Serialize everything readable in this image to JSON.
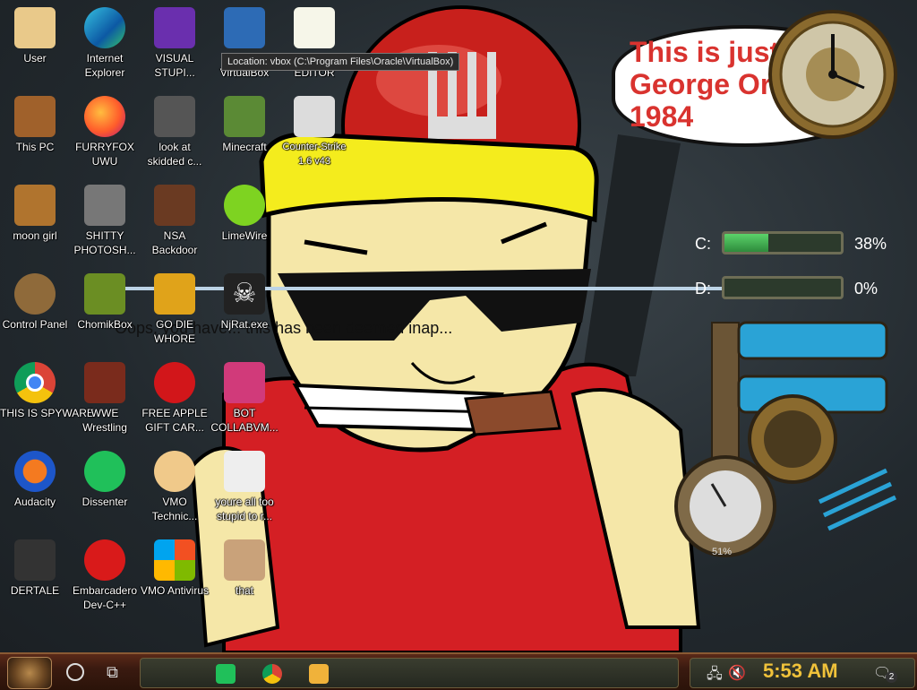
{
  "tooltip": {
    "text": "Location: vbox (C:\\Program Files\\Oracle\\VirtualBox)"
  },
  "desktop_icons": [
    {
      "label": "User"
    },
    {
      "label": "Internet Explorer"
    },
    {
      "label": "VISUAL STUPI..."
    },
    {
      "label": "VirtualBox"
    },
    {
      "label": "EDITOR"
    },
    {
      "label": "This PC"
    },
    {
      "label": "FURRYFOX UWU"
    },
    {
      "label": "look at skidded c..."
    },
    {
      "label": "Minecraft"
    },
    {
      "label": "Counter-Strike 1.6 v43"
    },
    {
      "label": "moon girl"
    },
    {
      "label": "SHITTY PHOTOSH..."
    },
    {
      "label": "NSA Backdoor"
    },
    {
      "label": "LimeWire"
    },
    {
      "label": "Control Panel"
    },
    {
      "label": "ChomikBox"
    },
    {
      "label": "GO DIE WHORE"
    },
    {
      "label": "NjRat.exe"
    },
    {
      "label": "THIS IS SPYWARE"
    },
    {
      "label": "WWE Wrestling"
    },
    {
      "label": "FREE APPLE GIFT CAR..."
    },
    {
      "label": "BOT COLLABVM..."
    },
    {
      "label": "Audacity"
    },
    {
      "label": "Dissenter"
    },
    {
      "label": "VMO Technic..."
    },
    {
      "label": "youre all too stupid to r..."
    },
    {
      "label": "DERTALE"
    },
    {
      "label": "Embarcadero Dev-C++"
    },
    {
      "label": "VMO Antivirus"
    },
    {
      "label": "that"
    }
  ],
  "wallpaper": {
    "bubble_text": "This is just like George Orwell's 1984",
    "banner_text": "Oops, you have... this has been deemed inap..."
  },
  "drive_gauges": [
    {
      "label": "C:",
      "percent": 38,
      "percent_text": "38%"
    },
    {
      "label": "D:",
      "percent": 0,
      "percent_text": "0%"
    }
  ],
  "cpu_gauge": {
    "value_text": "51%"
  },
  "taskbar": {
    "apps": [
      "Dissenter",
      "Google Chrome",
      "File Explorer"
    ],
    "time": "5:53 AM",
    "notification_count": "2",
    "accent": "#f0c23a"
  }
}
